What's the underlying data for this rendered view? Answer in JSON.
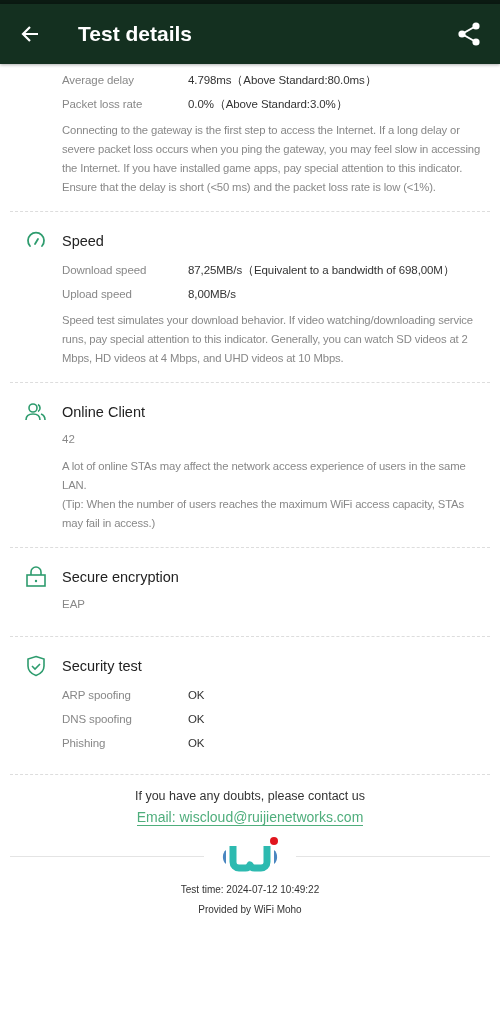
{
  "header": {
    "title": "Test details"
  },
  "sections": [
    {
      "rows": [
        {
          "label": "Average delay",
          "value": "4.798ms（Above Standard:80.0ms）"
        },
        {
          "label": "Packet loss rate",
          "value": "0.0%（Above Standard:3.0%）"
        }
      ],
      "description": "Connecting to the gateway is the first step to access the Internet. If a long delay or severe packet loss occurs when you ping the gateway, you may feel slow in accessing the Internet. If you have installed game apps, pay special attention to this indicator. Ensure that the delay is short (<50 ms) and the packet loss rate is low (<1%)."
    },
    {
      "title": "Speed",
      "rows": [
        {
          "label": "Download speed",
          "value": "87,25MB/s（Equivalent to a bandwidth of 698,00M）"
        },
        {
          "label": "Upload speed",
          "value": "8,00MB/s"
        }
      ],
      "description": "Speed test simulates your download behavior. If video watching/downloading service runs, pay special attention to this indicator. Generally, you can watch SD videos at 2 Mbps, HD videos at 4 Mbps, and UHD videos at 10 Mbps."
    },
    {
      "title": "Online Client",
      "value": "42",
      "description": "A lot of online STAs may affect the network access experience of users in the same LAN.\n(Tip: When the number of users reaches the maximum WiFi access capacity, STAs may fail in access.)"
    },
    {
      "title": "Secure encryption",
      "value": "EAP"
    },
    {
      "title": "Security test",
      "rows": [
        {
          "label": "ARP spoofing",
          "value": "OK"
        },
        {
          "label": "DNS spoofing",
          "value": "OK"
        },
        {
          "label": "Phishing",
          "value": "OK"
        }
      ]
    }
  ],
  "footer": {
    "contact": "If you have any doubts, please contact us",
    "email": "Email: wiscloud@ruijienetworks.com",
    "test_time": "Test time: 2024-07-12 10:49:22",
    "provided_by": "Provided by WiFi Moho"
  }
}
